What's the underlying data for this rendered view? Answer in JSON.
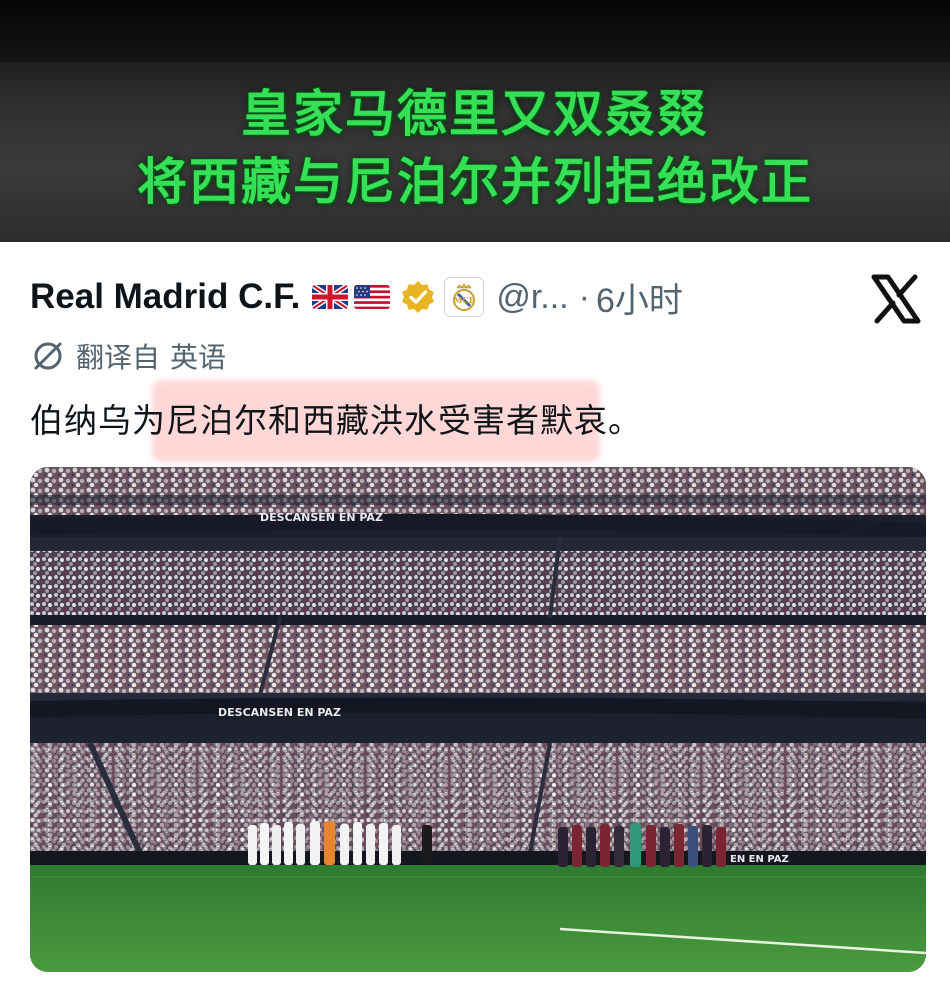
{
  "banner": {
    "line1": "皇家马德里又双叒叕",
    "line2": "将西藏与尼泊尔并列拒绝改正"
  },
  "post": {
    "author": "Real Madrid C.F.",
    "flags": [
      "uk-flag",
      "us-flag"
    ],
    "handle": "@r...",
    "separator": "·",
    "time": "6小时",
    "translated_label": "翻译自",
    "translated_lang": "英语",
    "text": "伯纳乌为尼泊尔和西藏洪水受害者默哀。",
    "platform_icon": "x-logo-icon"
  },
  "photo": {
    "banner_text_top": "DESCANSEN EN PAZ",
    "banner_text_mid": "DESCANSEN EN PAZ",
    "banner_text_pitch": "EN EN PAZ"
  },
  "colors": {
    "headline_green": "#35e056",
    "highlight": "#ffb3b3",
    "pitch_green": "#3f8a3a",
    "verified_gold": "#e8b422"
  }
}
